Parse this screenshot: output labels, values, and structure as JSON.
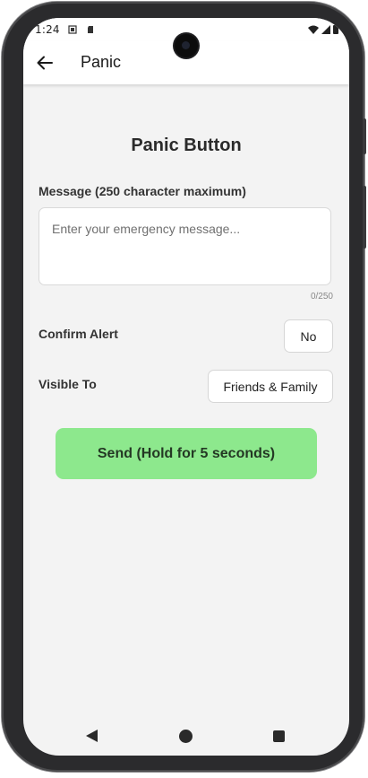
{
  "status_bar": {
    "time": "1:24",
    "icons": [
      "screenshot-icon",
      "sd-card-icon",
      "wifi-icon",
      "signal-icon",
      "battery-icon"
    ]
  },
  "app_bar": {
    "title": "Panic",
    "back_icon": "arrow-left-icon"
  },
  "panic": {
    "heading": "Panic Button",
    "message_label": "Message (250 character maximum)",
    "message_value": "",
    "message_placeholder": "Enter your emergency message...",
    "char_count": "0/250",
    "confirm_label": "Confirm Alert",
    "confirm_value": "No",
    "visible_label": "Visible To",
    "visible_value": "Friends & Family",
    "send_label": "Send (Hold for 5 seconds)"
  },
  "nav_bar": {
    "items": [
      "back-triangle-icon",
      "home-circle-icon",
      "recents-square-icon"
    ]
  },
  "colors": {
    "send_button": "#8de88d",
    "screen_bg": "#f3f3f3",
    "app_bar_bg": "#ffffff"
  }
}
